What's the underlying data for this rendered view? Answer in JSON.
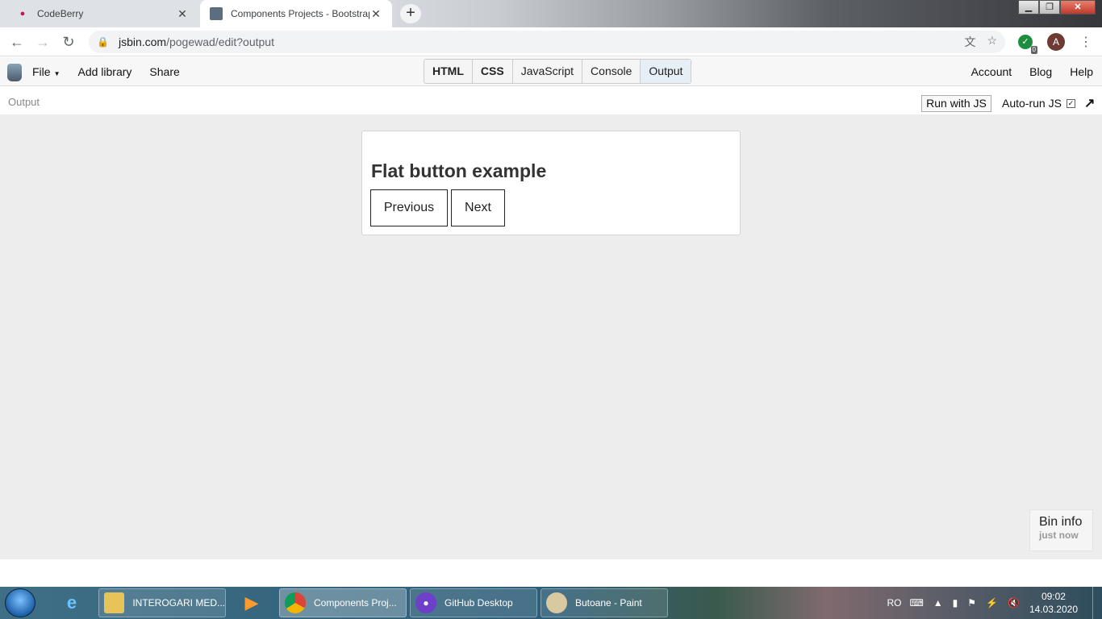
{
  "browser": {
    "tabs": [
      {
        "title": "CodeBerry",
        "icon": "raspberry-icon",
        "active": false
      },
      {
        "title": "Components Projects - Bootstrap",
        "icon": "jsbin-icon",
        "active": true
      }
    ],
    "url_host": "jsbin.com",
    "url_path": "/pogewad/edit?output",
    "extension_badge": "0",
    "profile_initial": "A"
  },
  "jsbin": {
    "menu": {
      "file": "File",
      "add_library": "Add library",
      "share": "Share"
    },
    "panels": [
      "HTML",
      "CSS",
      "JavaScript",
      "Console",
      "Output"
    ],
    "right_links": {
      "account": "Account",
      "blog": "Blog",
      "help": "Help"
    },
    "output_label": "Output",
    "run_with_js": "Run with JS",
    "auto_run_js": "Auto-run JS",
    "auto_run_checked": true
  },
  "output": {
    "heading": "Flat button example",
    "buttons": {
      "previous": "Previous",
      "next": "Next"
    },
    "bin_info": {
      "title": "Bin info",
      "time": "just now"
    }
  },
  "taskbar": {
    "tasks": [
      {
        "label": "INTEROGARI MED...",
        "icon": "folder-icon"
      },
      {
        "label": "Components Proj...",
        "icon": "chrome-icon"
      },
      {
        "label": "GitHub Desktop",
        "icon": "github-icon"
      },
      {
        "label": "Butoane - Paint",
        "icon": "paint-icon"
      }
    ],
    "language": "RO",
    "time": "09:02",
    "date": "14.03.2020"
  }
}
